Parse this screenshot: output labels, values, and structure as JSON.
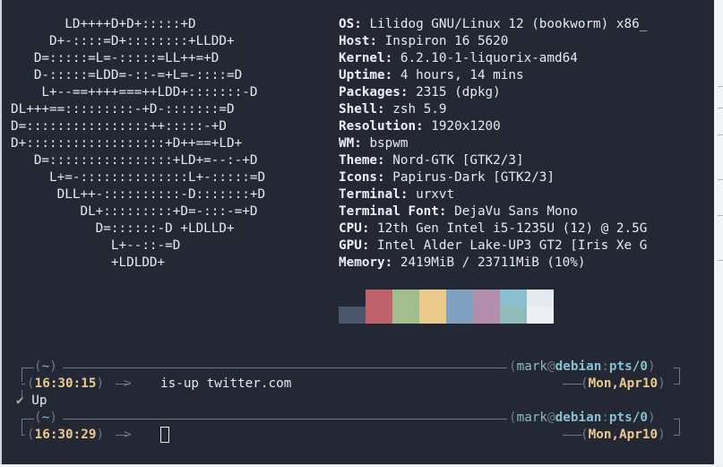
{
  "logo_lines": [
    "       LD++++D+D+:::::+D",
    "     D+-::::=D+::::::::+LLDD+",
    "   D=:::::=L=-:::::=LL++=+D",
    "   D-:::::=LDD=-::-=+L=-::::=D",
    "    L+--==++++===++LDD+:::::::-D",
    "DL+++==:::::::::-+D-:::::::=D",
    "D=::::::::::::::::++:::::-+D",
    "D+::::::::::::::::::+D++==+LD+",
    "   D=::::::::::::::::+LD+=--:-+D",
    "     L+=-::::::::::::::L+-:::::=D",
    "      DLL++-::::::::::-D:::::::+D",
    "         DL+:::::::::+D=-:::-=+D",
    "           D=::::::-D +LDLLD+",
    "             L+--::-=D",
    "             +LDLDD+"
  ],
  "info": [
    {
      "key": "OS",
      "value": "Lilidog GNU/Linux 12 (bookworm) x86_"
    },
    {
      "key": "Host",
      "value": "Inspiron 16 5620"
    },
    {
      "key": "Kernel",
      "value": "6.2.10-1-liquorix-amd64"
    },
    {
      "key": "Uptime",
      "value": "4 hours, 14 mins"
    },
    {
      "key": "Packages",
      "value": "2315 (dpkg)"
    },
    {
      "key": "Shell",
      "value": "zsh 5.9"
    },
    {
      "key": "Resolution",
      "value": "1920x1200"
    },
    {
      "key": "WM",
      "value": "bspwm"
    },
    {
      "key": "Theme",
      "value": "Nord-GTK [GTK2/3]"
    },
    {
      "key": "Icons",
      "value": "Papirus-Dark [GTK2/3]"
    },
    {
      "key": "Terminal",
      "value": "urxvt"
    },
    {
      "key": "Terminal Font",
      "value": "DejaVu Sans Mono"
    },
    {
      "key": "CPU",
      "value": "12th Gen Intel i5-1235U (12) @ 2.5G"
    },
    {
      "key": "GPU",
      "value": "Intel Alder Lake-UP3 GT2 [Iris Xe G"
    },
    {
      "key": "Memory",
      "value": "2419MiB / 23711MiB (10%)"
    }
  ],
  "palette": [
    {
      "top": "#232834",
      "bottom": "#4c566a"
    },
    {
      "top": "#bf616a",
      "bottom": "#bf616a"
    },
    {
      "top": "#a3be8c",
      "bottom": "#a3be8c"
    },
    {
      "top": "#ebcb8b",
      "bottom": "#ebcb8b"
    },
    {
      "top": "#81a1c1",
      "bottom": "#81a1c1"
    },
    {
      "top": "#b48ead",
      "bottom": "#b48ead"
    },
    {
      "top": "#88c0d0",
      "bottom": "#8fbcbb"
    },
    {
      "top": "#e5e9f0",
      "bottom": "#eceff4"
    }
  ],
  "prompts": [
    {
      "dir": "~",
      "user": "mark",
      "host": "debian",
      "tty": "pts/0",
      "time": "16:30:15",
      "date": "Mon,Apr10",
      "command": "is-up twitter.com",
      "output_icon": "check-icon",
      "output_mark": "✔",
      "output": "Up"
    },
    {
      "dir": "~",
      "user": "mark",
      "host": "debian",
      "tty": "pts/0",
      "time": "16:30:29",
      "date": "Mon,Apr10",
      "command": ""
    }
  ],
  "colors": {
    "background": "#232834",
    "foreground": "#e5e9f0",
    "frame": "#6f7887",
    "accent_yellow": "#ebcb8b",
    "accent_cyan": "#88c0d0"
  }
}
